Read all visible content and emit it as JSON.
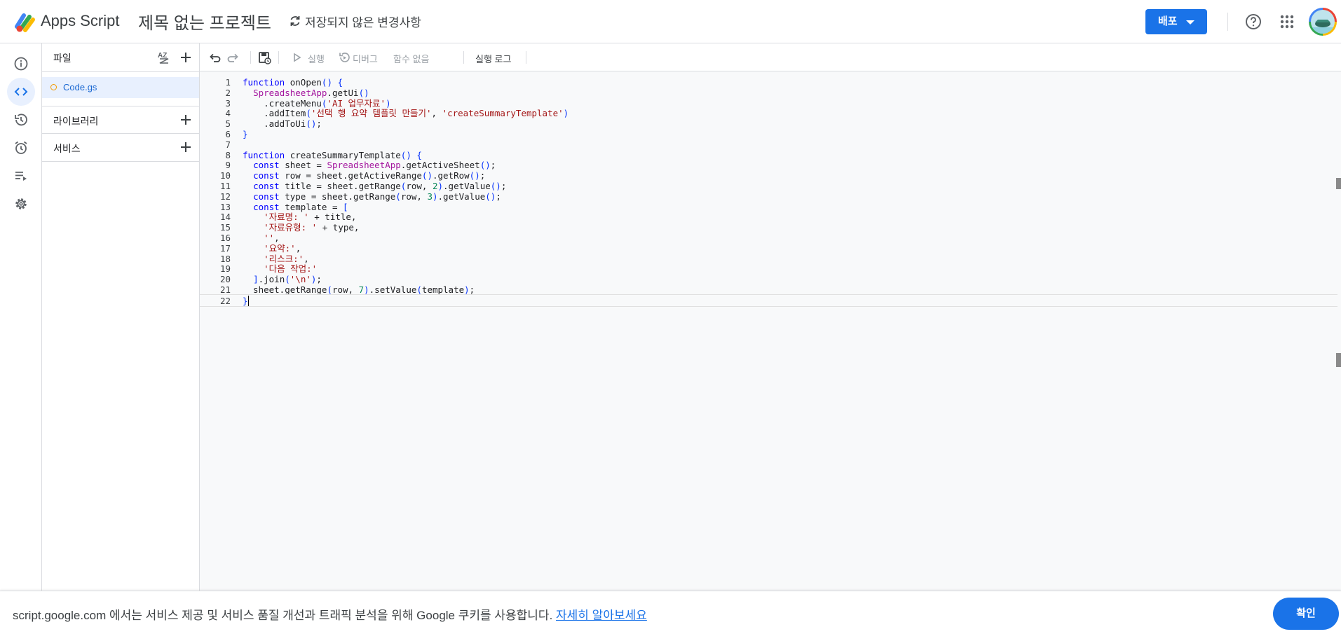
{
  "header": {
    "app_name": "Apps Script",
    "project_title": "제목 없는 프로젝트",
    "save_status": "저장되지 않은 변경사항",
    "deploy_label": "배포"
  },
  "rail": {
    "items": [
      "overview-icon",
      "editor-icon",
      "history-icon",
      "triggers-icon",
      "executions-icon",
      "settings-icon"
    ],
    "active": "editor-icon"
  },
  "files_panel": {
    "title": "파일",
    "sort_label": "AZ",
    "files": [
      {
        "name": "Code.gs"
      }
    ],
    "sections": [
      {
        "label": "라이브러리"
      },
      {
        "label": "서비스"
      }
    ]
  },
  "toolbar": {
    "run_label": "실행",
    "debug_label": "디버그",
    "function_select": "함수 없음",
    "execution_log_label": "실행 로그"
  },
  "code": {
    "lines": [
      "function onOpen() {",
      "  SpreadsheetApp.getUi()",
      "    .createMenu('AI 업무자료')",
      "    .addItem('선택 행 요약 템플릿 만들기', 'createSummaryTemplate')",
      "    .addToUi();",
      "}",
      "",
      "function createSummaryTemplate() {",
      "  const sheet = SpreadsheetApp.getActiveSheet();",
      "  const row = sheet.getActiveRange().getRow();",
      "  const title = sheet.getRange(row, 2).getValue();",
      "  const type = sheet.getRange(row, 3).getValue();",
      "  const template = [",
      "    '자료명: ' + title,",
      "    '자료유형: ' + type,",
      "    '',",
      "    '요약:',",
      "    '리스크:',",
      "    '다음 작업:'",
      "  ].join('\\n');",
      "  sheet.getRange(row, 7).setValue(template);",
      "}"
    ],
    "current_line": 22
  },
  "cookie_bar": {
    "text": "script.google.com 에서는 서비스 제공 및 서비스 품질 개선과 트래픽 분석을 위해 Google 쿠키를 사용합니다.",
    "link": "자세히 알아보세요",
    "ok_label": "확인"
  },
  "colors": {
    "accent": "#1a73e8",
    "active_bg": "#e8f0fe",
    "keyword": "#0000ff",
    "string": "#a31515",
    "number": "#098658",
    "class": "#a3159e"
  }
}
